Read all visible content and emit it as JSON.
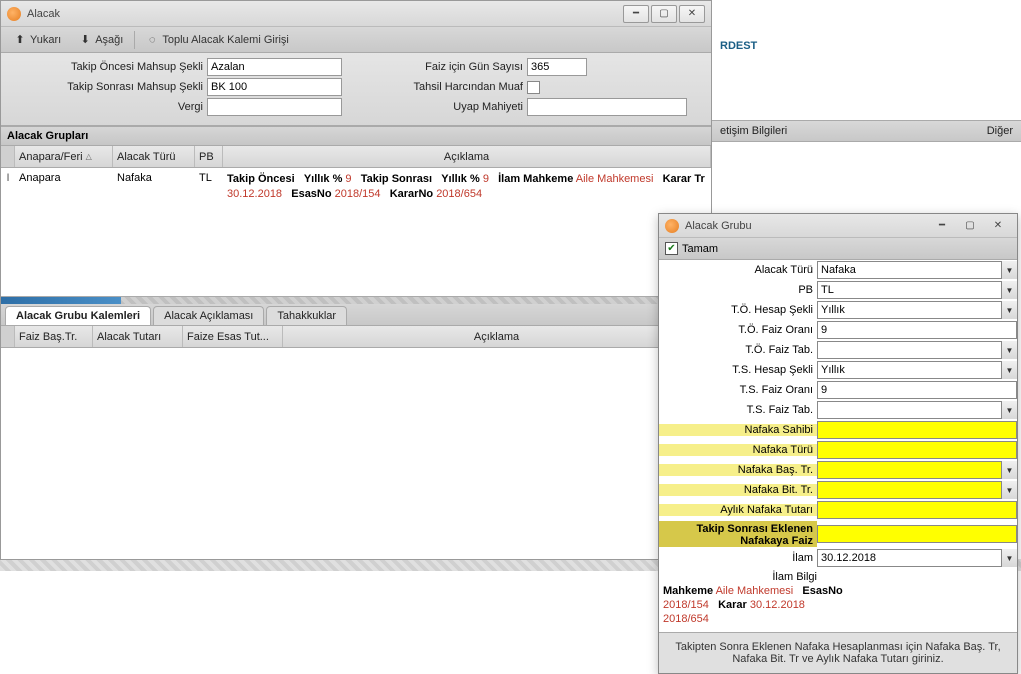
{
  "window": {
    "title": "Alacak"
  },
  "toolbar": {
    "up": "Yukarı",
    "down": "Aşağı",
    "bulk": "Toplu Alacak Kalemi Girişi"
  },
  "form": {
    "labels": {
      "takip_oncesi_mahsup": "Takip Öncesi Mahsup Şekli",
      "takip_sonrasi_mahsup": "Takip Sonrası Mahsup Şekli",
      "vergi": "Vergi",
      "faiz_gun_sayisi": "Faiz için Gün Sayısı",
      "tahsil_harcindan_muaf": "Tahsil Harcından Muaf",
      "uyap_mahiyeti": "Uyap Mahiyeti"
    },
    "values": {
      "takip_oncesi_mahsup": "Azalan",
      "takip_sonrasi_mahsup": "BK 100",
      "vergi": "",
      "faiz_gun_sayisi": "365",
      "uyap_mahiyeti": ""
    }
  },
  "sections": {
    "alacak_gruplari": "Alacak Grupları",
    "alacak_grubu_kalemleri": "Alacak Grubu Kalemleri"
  },
  "grid1": {
    "headers": {
      "anapara_feri": "Anapara/Feri",
      "alacak_turu": "Alacak Türü",
      "pb": "PB",
      "aciklama": "Açıklama"
    },
    "row": {
      "anapara_feri": "Anapara",
      "alacak_turu": "Nafaka",
      "pb": "TL",
      "desc": {
        "takip_oncesi": "Takip Öncesi",
        "yillik1_lbl": "Yıllık %",
        "yillik1_val": "9",
        "takip_sonrasi": "Takip Sonrası",
        "yillik2_lbl": "Yıllık %",
        "yillik2_val": "9",
        "ilam_mahkeme_lbl": "İlam Mahkeme",
        "ilam_mahkeme_val": "Aile Mahkemesi",
        "karar_tr_lbl": "Karar Tr",
        "karar_tr_val": "30.12.2018",
        "esas_no_lbl": "EsasNo",
        "esas_no_val": "2018/154",
        "karar_no_lbl": "KararNo",
        "karar_no_val": "2018/654"
      }
    }
  },
  "tabs": {
    "t1": "Alacak Grubu Kalemleri",
    "t2": "Alacak Açıklaması",
    "t3": "Tahakkuklar"
  },
  "grid2": {
    "headers": {
      "faiz_bas_tr": "Faiz Baş.Tr.",
      "alacak_tutari": "Alacak Tutarı",
      "faize_esas_tut": "Faize Esas Tut...",
      "aciklama": "Açıklama"
    }
  },
  "right": {
    "top_text": "RDEST",
    "bar_left": "etişim Bilgileri",
    "bar_right": "Diğer"
  },
  "dialog": {
    "title": "Alacak Grubu",
    "tamam": "Tamam",
    "labels": {
      "alacak_turu": "Alacak Türü",
      "pb": "PB",
      "to_hesap_sekli": "T.Ö. Hesap Şekli",
      "to_faiz_orani": "T.Ö. Faiz Oranı",
      "to_faiz_tab": "T.Ö. Faiz Tab.",
      "ts_hesap_sekli": "T.S. Hesap Şekli",
      "ts_faiz_orani": "T.S. Faiz Oranı",
      "ts_faiz_tab": "T.S. Faiz Tab.",
      "nafaka_sahibi": "Nafaka Sahibi",
      "nafaka_turu": "Nafaka Türü",
      "nafaka_bas_tr": "Nafaka Baş. Tr.",
      "nafaka_bit_tr": "Nafaka Bit. Tr.",
      "aylik_nafaka_tutari": "Aylık Nafaka Tutarı",
      "takip_sonrasi_eklenen": "Takip Sonrası Eklenen Nafakaya Faiz",
      "ilam": "İlam",
      "ilam_bilgi": "İlam Bilgi"
    },
    "values": {
      "alacak_turu": "Nafaka",
      "pb": "TL",
      "to_hesap_sekli": "Yıllık",
      "to_faiz_orani": "9",
      "to_faiz_tab": "",
      "ts_hesap_sekli": "Yıllık",
      "ts_faiz_orani": "9",
      "ts_faiz_tab": "",
      "nafaka_sahibi": "",
      "nafaka_turu": "",
      "nafaka_bas_tr": "",
      "nafaka_bit_tr": "",
      "aylik_nafaka_tutari": "",
      "takip_sonrasi_eklenen": "",
      "ilam": "30.12.2018"
    },
    "ilam_bilgi": {
      "mahkeme_lbl": "Mahkeme",
      "mahkeme_val": "Aile Mahkemesi",
      "esasno_lbl": "EsasNo",
      "esasno_val": "2018/154",
      "karar_lbl": "Karar",
      "karar_tr": "30.12.2018",
      "karar_no": "2018/654"
    },
    "footer": "Takipten Sonra Eklenen Nafaka Hesaplanması için Nafaka Baş. Tr, Nafaka Bit. Tr ve Aylık Nafaka Tutarı giriniz."
  }
}
